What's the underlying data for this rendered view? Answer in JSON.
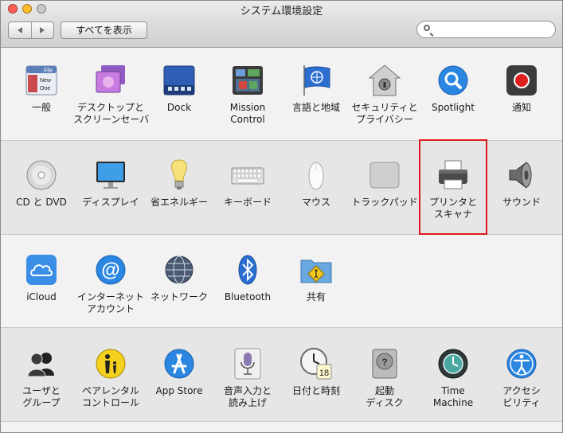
{
  "window": {
    "title": "システム環境設定"
  },
  "toolbar": {
    "back": "◀",
    "forward": "▶",
    "show_all": "すべてを表示",
    "search_placeholder": ""
  },
  "colors": {
    "highlight": "#e0191e",
    "close": "#ff5f57",
    "minimize": "#febc2e",
    "zoom": "#c8c8c8"
  },
  "panes": {
    "general": {
      "label": "一般",
      "icon": "general-icon"
    },
    "desktop": {
      "label": "デスクトップと\nスクリーンセーバ",
      "icon": "desktop-icon"
    },
    "dock": {
      "label": "Dock",
      "icon": "dock-icon"
    },
    "mission": {
      "label": "Mission\nControl",
      "icon": "mission-control-icon"
    },
    "language": {
      "label": "言語と地域",
      "icon": "language-icon"
    },
    "security": {
      "label": "セキュリティと\nプライバシー",
      "icon": "security-icon"
    },
    "spotlight": {
      "label": "Spotlight",
      "icon": "spotlight-icon"
    },
    "notifications": {
      "label": "通知",
      "icon": "notifications-icon"
    },
    "cddvd": {
      "label": "CD と DVD",
      "icon": "cd-icon"
    },
    "displays": {
      "label": "ディスプレイ",
      "icon": "display-icon"
    },
    "energy": {
      "label": "省エネルギー",
      "icon": "bulb-icon"
    },
    "keyboard": {
      "label": "キーボード",
      "icon": "keyboard-icon"
    },
    "mouse": {
      "label": "マウス",
      "icon": "mouse-icon"
    },
    "trackpad": {
      "label": "トラックパッド",
      "icon": "trackpad-icon"
    },
    "printers": {
      "label": "プリンタと\nスキャナ",
      "icon": "printer-icon"
    },
    "sound": {
      "label": "サウンド",
      "icon": "speaker-icon"
    },
    "icloud": {
      "label": "iCloud",
      "icon": "icloud-icon"
    },
    "internet": {
      "label": "インターネット\nアカウント",
      "icon": "at-icon"
    },
    "network": {
      "label": "ネットワーク",
      "icon": "network-icon"
    },
    "bluetooth": {
      "label": "Bluetooth",
      "icon": "bluetooth-icon"
    },
    "sharing": {
      "label": "共有",
      "icon": "sharing-folder-icon"
    },
    "users": {
      "label": "ユーザと\nグループ",
      "icon": "users-icon"
    },
    "parental": {
      "label": "ペアレンタル\nコントロール",
      "icon": "parental-icon"
    },
    "appstore": {
      "label": "App Store",
      "icon": "appstore-icon"
    },
    "dictation": {
      "label": "音声入力と\n読み上げ",
      "icon": "microphone-icon"
    },
    "datetime": {
      "label": "日付と時刻",
      "icon": "clock-icon"
    },
    "startup": {
      "label": "起動\nディスク",
      "icon": "disk-icon"
    },
    "timemachine": {
      "label": "Time\nMachine",
      "icon": "time-machine-icon"
    },
    "accessibility": {
      "label": "アクセシ\nビリティ",
      "icon": "accessibility-icon"
    }
  },
  "general_icon_text": {
    "line1": "File",
    "line2": "New",
    "line3": "One"
  },
  "datetime_icon_text": "18"
}
